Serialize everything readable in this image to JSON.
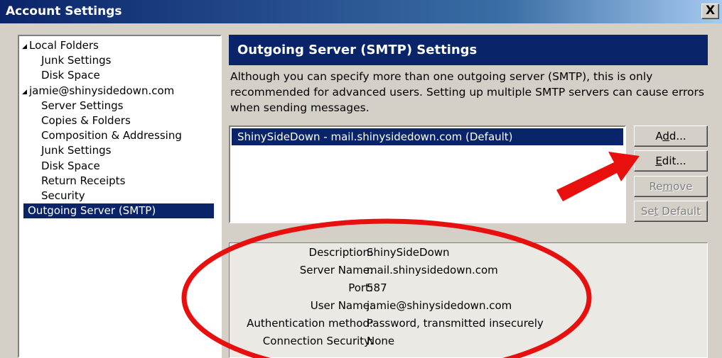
{
  "window": {
    "title": "Account Settings",
    "close_label": "X"
  },
  "tree": {
    "items": [
      {
        "label": "Local Folders",
        "level": 0,
        "expanded": true
      },
      {
        "label": "Junk Settings",
        "level": 1
      },
      {
        "label": "Disk Space",
        "level": 1
      },
      {
        "label": "jamie@shinysidedown.com",
        "level": 0,
        "expanded": true
      },
      {
        "label": "Server Settings",
        "level": 1
      },
      {
        "label": "Copies & Folders",
        "level": 1
      },
      {
        "label": "Composition & Addressing",
        "level": 1
      },
      {
        "label": "Junk Settings",
        "level": 1
      },
      {
        "label": "Disk Space",
        "level": 1
      },
      {
        "label": "Return Receipts",
        "level": 1
      },
      {
        "label": "Security",
        "level": 1
      },
      {
        "label": "Outgoing Server (SMTP)",
        "level": 0,
        "selected": true
      }
    ]
  },
  "panel": {
    "header": "Outgoing Server (SMTP) Settings",
    "description": "Although you can specify more than one outgoing server (SMTP), this is only recommended for advanced users. Setting up multiple SMTP servers can cause errors when sending messages."
  },
  "servers": [
    {
      "label": "ShinySideDown - mail.shinysidedown.com (Default)",
      "selected": true
    }
  ],
  "buttons": {
    "add": {
      "pre": "A",
      "key": "d",
      "post": "d..."
    },
    "edit": {
      "pre": "",
      "key": "E",
      "post": "dit..."
    },
    "remove": {
      "pre": "Re",
      "key": "m",
      "post": "ove"
    },
    "set_default": {
      "pre": "Se",
      "key": "t",
      "post": " Default"
    }
  },
  "details": {
    "description_label": "Description:",
    "description_value": "ShinySideDown",
    "server_name_label": "Server Name:",
    "server_name_value": "mail.shinysidedown.com",
    "port_label": "Port:",
    "port_value": "587",
    "user_name_label": "User Name:",
    "user_name_value": "jamie@shinysidedown.com",
    "auth_label": "Authentication method:",
    "auth_value": "Password, transmitted insecurely",
    "security_label": "Connection Security:",
    "security_value": "None"
  },
  "annotation": {
    "color": "#e8100f"
  },
  "colors": {
    "selection": "#0a246a",
    "dialog_bg": "#d4d0c8"
  }
}
